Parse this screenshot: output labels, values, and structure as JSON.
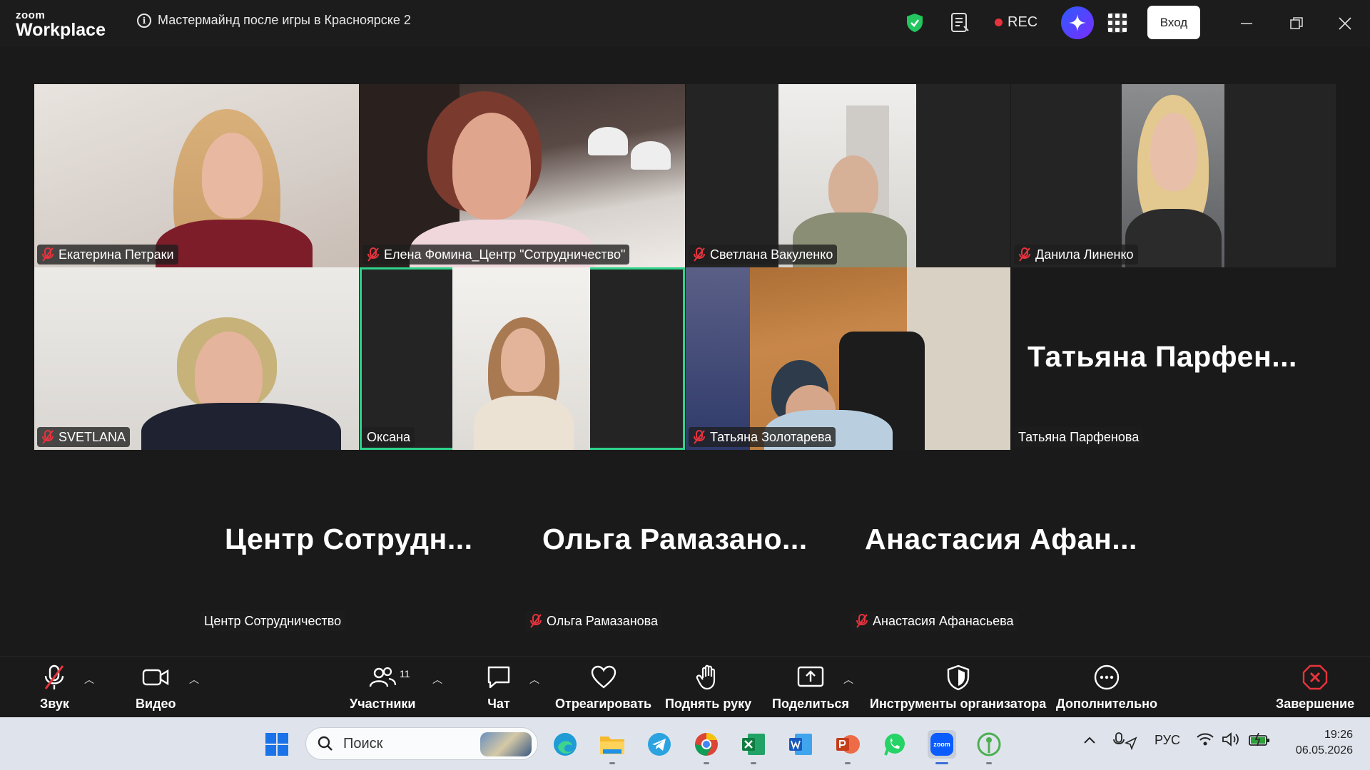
{
  "app": {
    "logo_top": "zoom",
    "logo_bottom": "Workplace",
    "meeting_title": "Мастермайнд после игры в Красноярске 2",
    "rec_label": "REC",
    "login_label": "Вход"
  },
  "tiles": {
    "t1": {
      "name": "Екатерина Петраки"
    },
    "t2": {
      "name": "Елена Фомина_Центр \"Сотрудничество\""
    },
    "t3": {
      "name": "Светлана Вакуленко"
    },
    "t4": {
      "name": "Данила Линенко"
    },
    "t5": {
      "name": "SVETLANA"
    },
    "t6": {
      "name": "Оксана"
    },
    "t7": {
      "name": "Татьяна Золотарева"
    },
    "t8": {
      "name": "Татьяна Парфенова",
      "big": "Татьяна  Парфен..."
    },
    "t9": {
      "name": "Центр Сотрудничество",
      "big": "Центр  Сотрудн..."
    },
    "t10": {
      "name": "Ольга Рамазанова",
      "big": "Ольга  Рамазано..."
    },
    "t11": {
      "name": "Анастасия Афанасьева",
      "big": "Анастасия  Афан..."
    }
  },
  "toolbar": {
    "audio": "Звук",
    "video": "Видео",
    "participants": "Участники",
    "participants_count": "11",
    "chat": "Чат",
    "react": "Отреагировать",
    "raise_hand": "Поднять руку",
    "share": "Поделиться",
    "host_tools": "Инструменты организатора",
    "more": "Дополнительно",
    "end": "Завершение"
  },
  "taskbar": {
    "search_placeholder": "Поиск",
    "lang": "РУС",
    "time": "19:26",
    "date": "06.05.2026"
  },
  "colors": {
    "accent_speaking": "#2ed38a",
    "rec_dot": "#e8333d",
    "end_red": "#e8333d",
    "mic_off_red": "#e8333d"
  }
}
